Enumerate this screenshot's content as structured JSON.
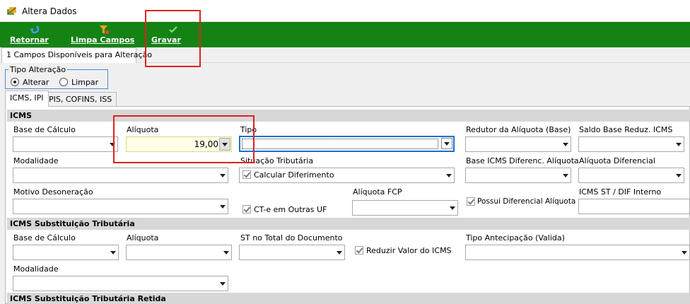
{
  "window": {
    "title": "Altera Dados",
    "icon": "app-icon"
  },
  "toolbar": {
    "buttons": [
      {
        "label": "Retornar",
        "icon": "back-arrow-icon"
      },
      {
        "label": "Limpa Campos",
        "icon": "eraser-icon"
      },
      {
        "label": "Gravar",
        "icon": "checkmark-icon"
      }
    ],
    "color": "#148314"
  },
  "outer_tab": {
    "label": "1 Campos Disponíveis para Alteração"
  },
  "tipo_alteracao": {
    "legend": "Tipo Alteração",
    "options": [
      {
        "label": "Alterar",
        "selected": true
      },
      {
        "label": "Limpar",
        "selected": false
      }
    ]
  },
  "inner_tabs": [
    {
      "label": "ICMS, IPI",
      "active": true
    },
    {
      "label": "PIS, COFINS, ISS",
      "active": false
    }
  ],
  "icms": {
    "header": "ICMS",
    "base_calculo": {
      "label": "Base de Cálculo",
      "value": ""
    },
    "aliquota": {
      "label": "Alíquota",
      "value": "19,00"
    },
    "tipo": {
      "label": "Tipo",
      "value": ""
    },
    "redutor": {
      "label": "Redutor da Alíquota (Base)",
      "value": ""
    },
    "saldo_base": {
      "label": "Saldo Base Reduz. ICMS",
      "value": ""
    },
    "modalidade": {
      "label": "Modalidade",
      "value": ""
    },
    "situacao": {
      "label": "Situação Tributária",
      "value": ""
    },
    "base_diferenc": {
      "label": "Base ICMS Diferenc. Alíquota",
      "value": ""
    },
    "aliquota_diferencial": {
      "label": "Alíquota Diferencial",
      "value": ""
    },
    "motivo": {
      "label": "Motivo Desoneração",
      "value": ""
    },
    "calcular_diferimento": {
      "label": "Calcular Diferimento",
      "checked": true
    },
    "cte_outras_uf": {
      "label": "CT-e em Outras UF",
      "checked": true
    },
    "aliquota_fcp": {
      "label": "Alíquota FCP",
      "value": ""
    },
    "possui_diferencial": {
      "label": "Possui Diferencial Alíquota",
      "checked": true
    },
    "icms_st_dif": {
      "label": "ICMS ST / DIF Interno",
      "value": ""
    }
  },
  "icms_st": {
    "header": "ICMS Substituição Tributária",
    "base_calculo": {
      "label": "Base de Cálculo",
      "value": ""
    },
    "aliquota": {
      "label": "Alíquota",
      "value": ""
    },
    "st_total": {
      "label": "ST no Total do Documento",
      "value": ""
    },
    "reduzir_valor": {
      "label": "Reduzir Valor do ICMS",
      "checked": true
    },
    "tipo_antecipacao": {
      "label": "Tipo Antecipação (Valida)",
      "value": ""
    },
    "modalidade": {
      "label": "Modalidade",
      "value": ""
    }
  },
  "icms_st_retida": {
    "header": "ICMS Substituição Tributária Retida"
  }
}
